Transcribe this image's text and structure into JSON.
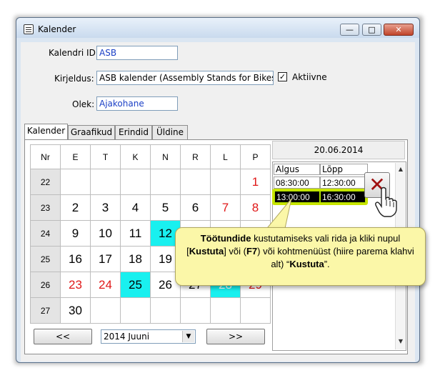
{
  "window": {
    "title": "Kalender",
    "min_glyph": "—",
    "max_glyph": "□",
    "close_glyph": "✕"
  },
  "form": {
    "calendar_id_label": "Kalendri ID:",
    "calendar_id_value": "ASB",
    "description_label": "Kirjeldus:",
    "description_value": "ASB kalender (Assembly Stands for Bikes)",
    "active_label": "Aktiivne",
    "active_checked": true,
    "state_label": "Olek:",
    "state_value": "Ajakohane"
  },
  "tabs": [
    "Kalender",
    "Graafikud",
    "Erindid",
    "Üldine"
  ],
  "calendar": {
    "headers": [
      "Nr",
      "E",
      "T",
      "K",
      "N",
      "R",
      "L",
      "P"
    ],
    "weeks": [
      {
        "nr": "22",
        "days": [
          "",
          "",
          "",
          "",
          "",
          "",
          "1"
        ]
      },
      {
        "nr": "23",
        "days": [
          "2",
          "3",
          "4",
          "5",
          "6",
          "7",
          "8"
        ]
      },
      {
        "nr": "24",
        "days": [
          "9",
          "10",
          "11",
          "12",
          "",
          "",
          ""
        ]
      },
      {
        "nr": "25",
        "days": [
          "16",
          "17",
          "18",
          "19",
          "",
          "",
          ""
        ]
      },
      {
        "nr": "26",
        "days": [
          "23",
          "24",
          "25",
          "26",
          "27",
          "28",
          "29"
        ]
      },
      {
        "nr": "27",
        "days": [
          "30",
          "",
          "",
          "",
          "",
          "",
          ""
        ]
      }
    ],
    "prev_label": "<<",
    "next_label": ">>",
    "month_select": "2014 Juuni"
  },
  "schedule": {
    "date": "20.06.2014",
    "col_start": "Algus",
    "col_end": "Lõpp",
    "rows": [
      {
        "start": "08:30:00",
        "end": "12:30:00"
      },
      {
        "start": "13:00:00",
        "end": "16:30:00"
      }
    ],
    "delete_glyph": "✕"
  },
  "callout": {
    "b1": "Töötundide",
    "t1": " kustutamiseks vali rida ja kliki nupul [",
    "b2": "Kustuta",
    "t2": "] või (",
    "b3": "F7",
    "t3": ") või kohtmenüüst (hiire parema klahvi alt) “",
    "b4": "Kustuta",
    "t4": "”."
  },
  "colors": {
    "weekend": "#e01818",
    "highlight_day": "#19f0ef",
    "callout_bg": "#fbf7a8",
    "selection_outline": "#c8e400"
  }
}
